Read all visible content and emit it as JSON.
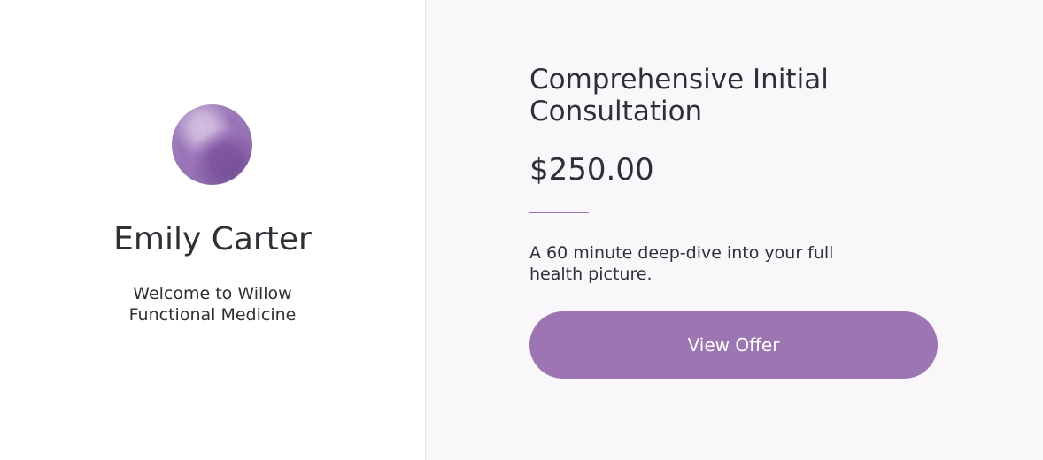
{
  "practitioner": {
    "name": "Emily Carter",
    "welcome": "Welcome to Willow Functional Medicine"
  },
  "offer": {
    "title": "Comprehensive Initial Consultation",
    "price": "$250.00",
    "description": "A 60 minute deep-dive into your full health picture.",
    "button_label": "View Offer"
  },
  "colors": {
    "accent": "#9c75b2",
    "panel_background": "#f9f7fa",
    "text": "#2f2f35"
  }
}
